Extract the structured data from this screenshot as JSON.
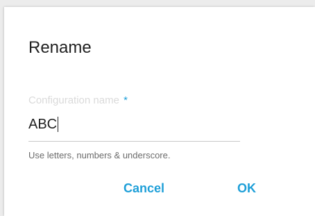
{
  "dialog": {
    "title": "Rename",
    "field": {
      "label": "Configuration name",
      "required_mark": "*",
      "value": "ABC"
    },
    "hint": "Use letters, numbers & underscore.",
    "buttons": {
      "cancel_label": "Cancel",
      "ok_label": "OK"
    }
  },
  "colors": {
    "accent": "#1e9fd8",
    "text": "#212121",
    "label": "#dadada",
    "hint": "#6b6b6b"
  }
}
